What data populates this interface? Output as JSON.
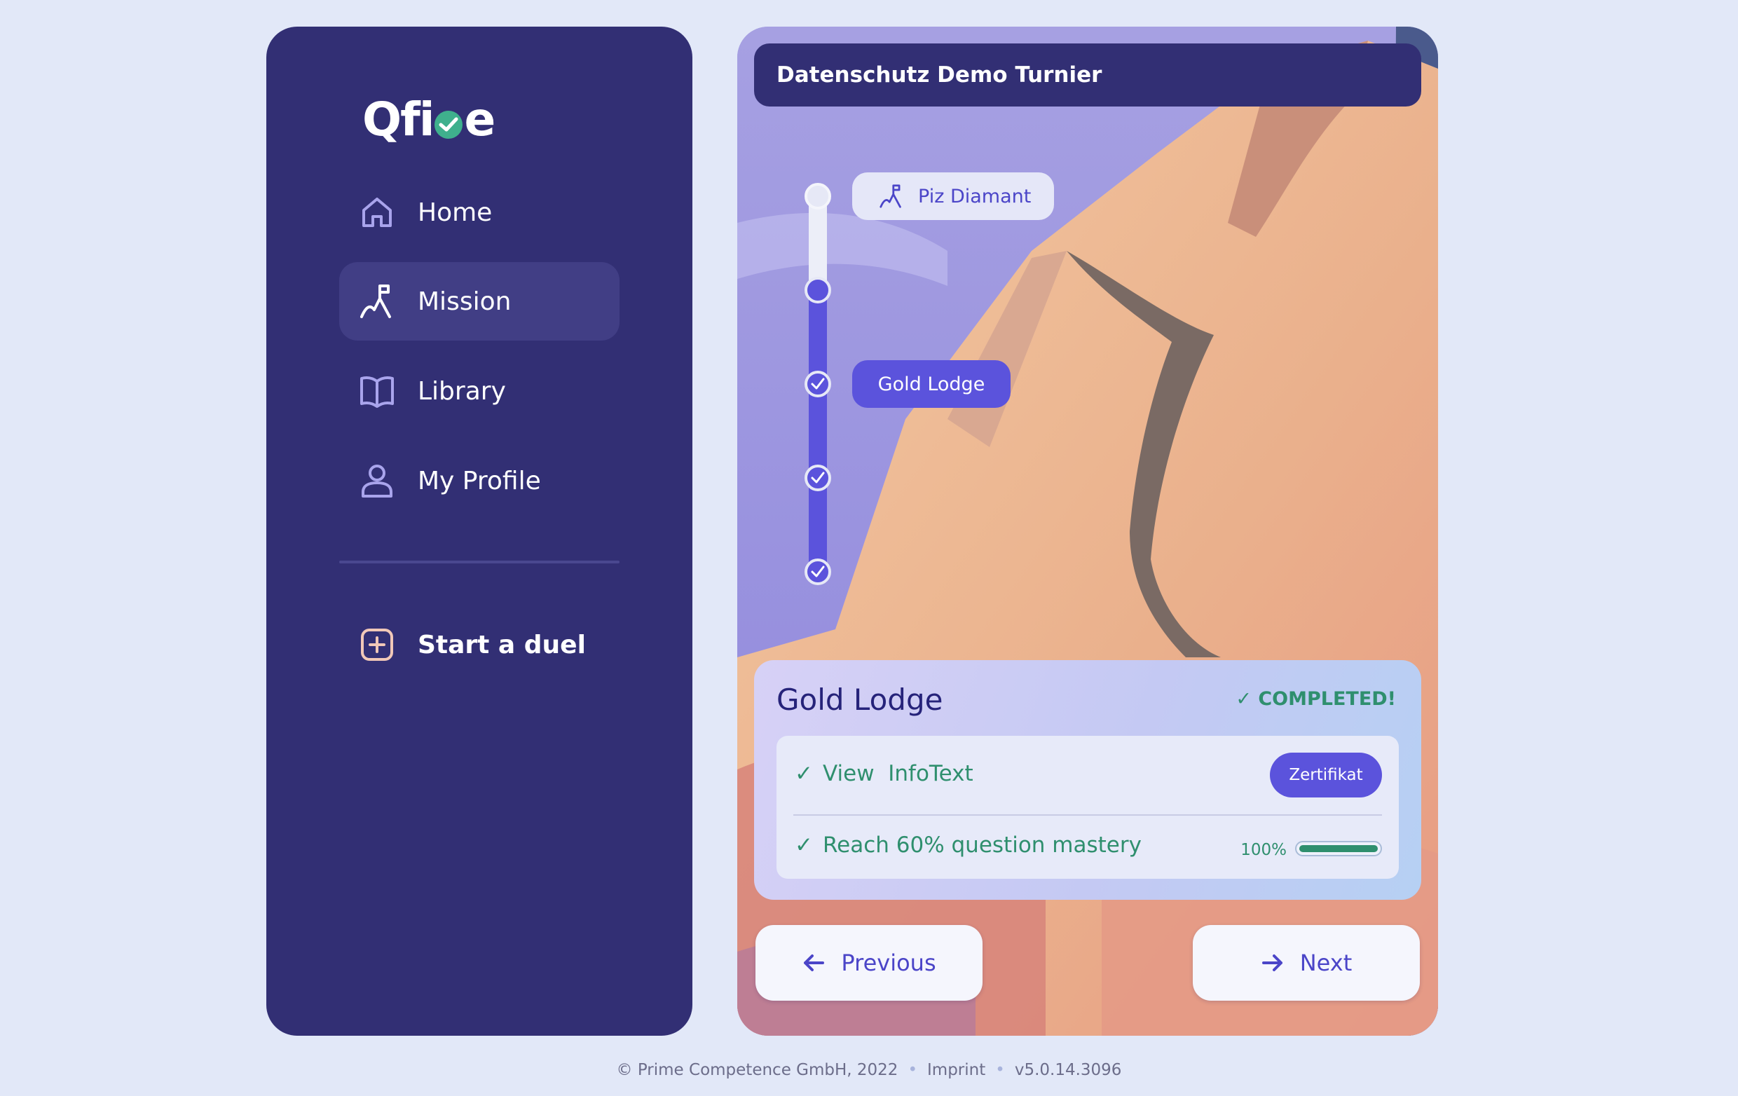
{
  "brand": {
    "logo_text_before": "Qfi",
    "logo_text_after": "e"
  },
  "sidebar": {
    "items": [
      {
        "label": "Home",
        "icon": "home-icon"
      },
      {
        "label": "Mission",
        "icon": "mission-flag-icon"
      },
      {
        "label": "Library",
        "icon": "book-icon"
      },
      {
        "label": "My Profile",
        "icon": "user-icon"
      }
    ],
    "duel": {
      "label": "Start a duel",
      "icon": "plus-square-icon"
    }
  },
  "main": {
    "title": "Datenschutz Demo Turnier",
    "stations": [
      {
        "label": "Piz Diamant",
        "icon": "mission-flag-icon"
      },
      {
        "label": "Gold Lodge"
      }
    ],
    "card": {
      "title": "Gold Lodge",
      "status": "✓ COMPLETED!",
      "requirements": [
        {
          "label": "View  InfoText",
          "button": "Zertifikat"
        },
        {
          "label": "Reach 60% question mastery",
          "progress_text": "100%",
          "progress": 1.0
        }
      ]
    },
    "buttons": {
      "previous": "Previous",
      "next": "Next"
    }
  },
  "footer": {
    "copyright": "© Prime Competence GmbH, 2022",
    "imprint": "Imprint",
    "version": "v5.0.14.3096"
  },
  "colors": {
    "sidebar_bg": "#322f74",
    "accent": "#5b53dc",
    "success": "#2f8f6e",
    "page_bg": "#e2e8f8"
  }
}
